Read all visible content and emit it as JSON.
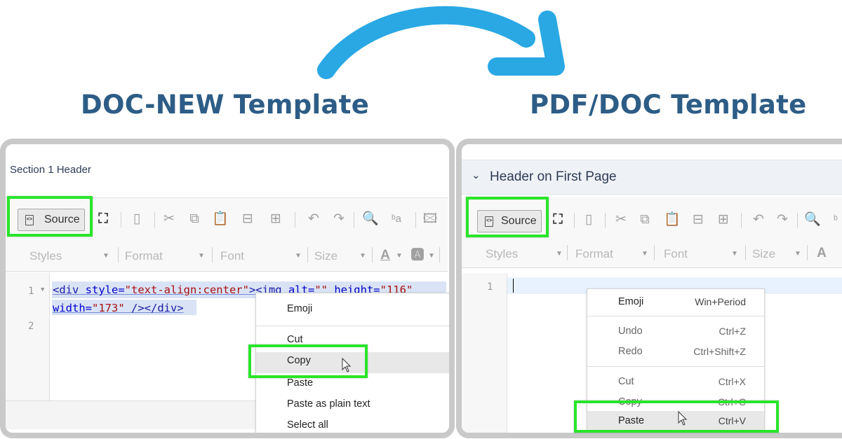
{
  "headings": {
    "left": "DOC-NEW Template",
    "right": "PDF/DOC Template"
  },
  "colors": {
    "arrow": "#29a8e4",
    "heading": "#2d5d86",
    "highlight": "#29e52b"
  },
  "left_panel": {
    "section_label": "Section 1 Header",
    "toolbar": {
      "source_label": "Source",
      "styles_label": "Styles",
      "format_label": "Format",
      "font_label": "Font",
      "size_label": "Size"
    },
    "editor": {
      "line_numbers": [
        "1",
        "2"
      ],
      "line1": {
        "open_div": "<div",
        "style_attr": " style=",
        "style_val": "\"text-align:center\"",
        "img_open": "><img",
        "alt_attr": " alt=",
        "alt_val": "\"\"",
        "height_attr": " height=",
        "height_val": "\"116\""
      },
      "line1b": {
        "width_attr": "width=",
        "width_val": "\"173\"",
        "close": " /></div>"
      }
    },
    "context_menu": {
      "items": [
        "Emoji",
        "Cut",
        "Copy",
        "Paste",
        "Paste as plain text",
        "Select all"
      ]
    }
  },
  "right_panel": {
    "section_label": "Header on First Page",
    "toolbar": {
      "source_label": "Source",
      "styles_label": "Styles",
      "format_label": "Format",
      "font_label": "Font",
      "size_label": "Size"
    },
    "editor": {
      "line_numbers": [
        "1"
      ]
    },
    "context_menu": {
      "items": [
        {
          "label": "Emoji",
          "shortcut": "Win+Period"
        },
        {
          "label": "Undo",
          "shortcut": "Ctrl+Z"
        },
        {
          "label": "Redo",
          "shortcut": "Ctrl+Shift+Z"
        },
        {
          "label": "Cut",
          "shortcut": "Ctrl+X"
        },
        {
          "label": "Copy",
          "shortcut": "Ctrl+C"
        },
        {
          "label": "Paste",
          "shortcut": "Ctrl+V"
        }
      ]
    }
  }
}
